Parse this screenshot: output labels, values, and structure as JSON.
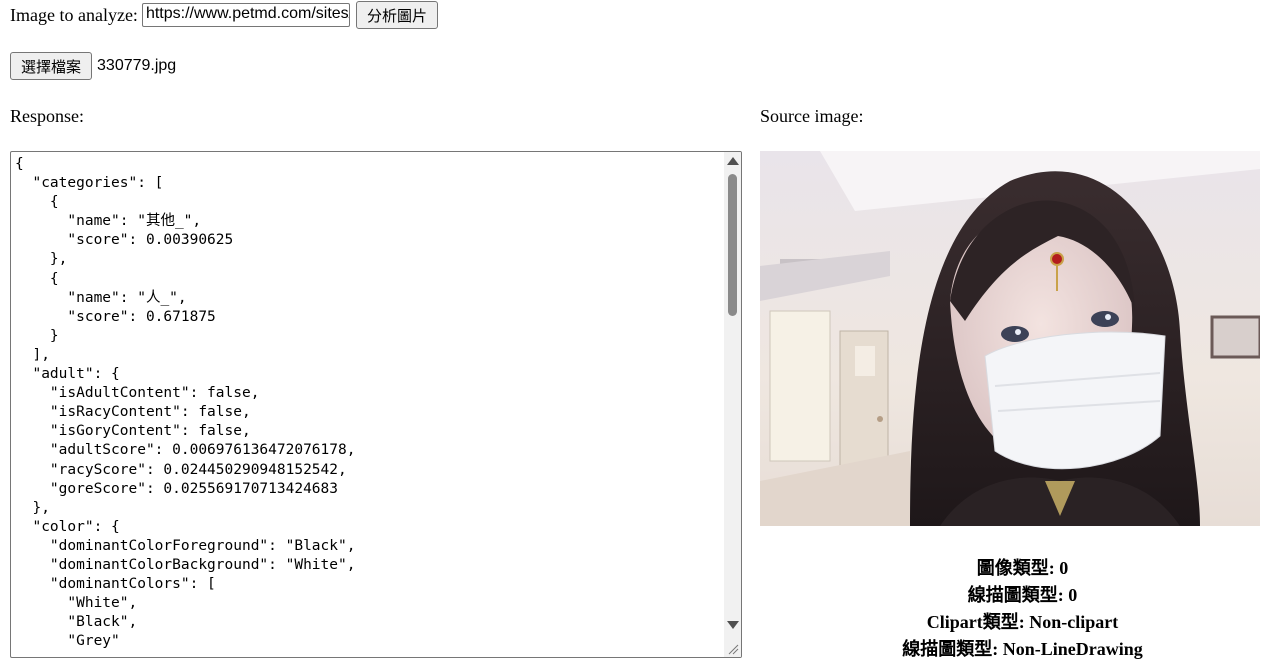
{
  "form": {
    "image_label": "Image to analyze:",
    "url_value": "https://www.petmd.com/sites/default/files/",
    "analyze_button": "分析圖片",
    "file_button": "選擇檔案",
    "file_name": "330779.jpg"
  },
  "response": {
    "label": "Response:",
    "json_text": "{\n  \"categories\": [\n    {\n      \"name\": \"其他_\",\n      \"score\": 0.00390625\n    },\n    {\n      \"name\": \"人_\",\n      \"score\": 0.671875\n    }\n  ],\n  \"adult\": {\n    \"isAdultContent\": false,\n    \"isRacyContent\": false,\n    \"isGoryContent\": false,\n    \"adultScore\": 0.006976136472076178,\n    \"racyScore\": 0.024450290948152542,\n    \"goreScore\": 0.025569170713424683\n  },\n  \"color\": {\n    \"dominantColorForeground\": \"Black\",\n    \"dominantColorBackground\": \"White\",\n    \"dominantColors\": [\n      \"White\",\n      \"Black\",\n      \"Grey\""
  },
  "source": {
    "label": "Source image:"
  },
  "image_info": {
    "image_type": "圖像類型: 0",
    "line_drawing_type": "線描圖類型: 0",
    "clipart_type": "Clipart類型: Non-clipart",
    "line_drawing_type_name": "線描圖類型: Non-LineDrawing"
  }
}
